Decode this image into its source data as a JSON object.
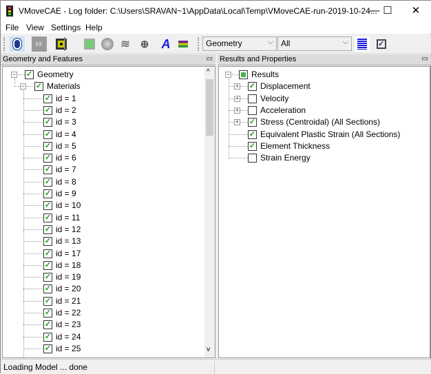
{
  "window": {
    "title": "VMoveCAE - Log folder: C:\\Users\\SRAVAN~1\\AppData\\Local\\Temp\\VMoveCAE-run-2019-10-24...",
    "minimize": "—",
    "maximize": "☐",
    "close": "✕"
  },
  "menu": [
    "File",
    "View",
    "Settings",
    "Help"
  ],
  "toolbar": {
    "buttons": [
      {
        "icon": "open-icon"
      },
      {
        "icon": "ff-icon"
      },
      {
        "icon": "save-icon"
      },
      {
        "icon": "cube-icon"
      },
      {
        "icon": "disc-icon"
      },
      {
        "icon": "waves-icon"
      },
      {
        "icon": "layers-add-icon"
      },
      {
        "icon": "text-a-icon",
        "glyph": "A"
      },
      {
        "icon": "stack-icon"
      }
    ],
    "combo1": "Geometry",
    "combo2": "All",
    "extra": [
      {
        "icon": "list-lines-icon"
      },
      {
        "icon": "checkbox-windows-icon"
      }
    ]
  },
  "left_panel": {
    "title": "Geometry and Features",
    "root": {
      "label": "Geometry",
      "checked": true
    },
    "materials": {
      "label": "Materials",
      "checked": true
    },
    "items": [
      "id = 1",
      "id = 2",
      "id = 3",
      "id = 4",
      "id = 5",
      "id = 6",
      "id = 7",
      "id = 8",
      "id = 9",
      "id = 10",
      "id = 11",
      "id = 12",
      "id = 13",
      "id = 17",
      "id = 18",
      "id = 19",
      "id = 20",
      "id = 21",
      "id = 22",
      "id = 23",
      "id = 24",
      "id = 25"
    ]
  },
  "right_panel": {
    "title": "Results and Properties",
    "root": {
      "label": "Results",
      "state": "partial"
    },
    "items": [
      {
        "label": "Displacement",
        "checked": true,
        "expandable": true
      },
      {
        "label": "Velocity",
        "checked": false,
        "expandable": true
      },
      {
        "label": "Acceleration",
        "checked": false,
        "expandable": true
      },
      {
        "label": "Stress (Centroidal) (All Sections)",
        "checked": true,
        "expandable": true
      },
      {
        "label": "Equivalent Plastic Strain (All Sections)",
        "checked": true,
        "expandable": false
      },
      {
        "label": "Element Thickness",
        "checked": true,
        "expandable": false
      },
      {
        "label": "Strain Energy",
        "checked": false,
        "expandable": false
      }
    ]
  },
  "status": "Loading Model ... done",
  "colors": {
    "check": "#1a9a1a",
    "accent": "#1a1adc"
  }
}
